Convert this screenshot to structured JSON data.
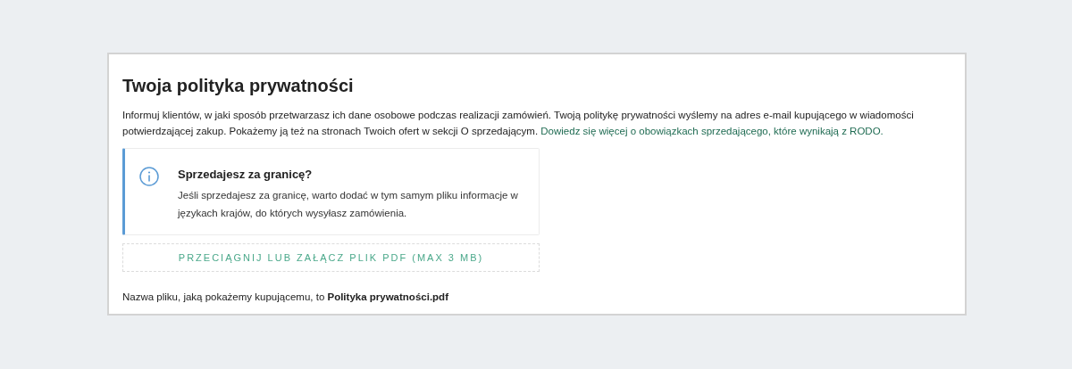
{
  "title": "Twoja polityka prywatności",
  "intro": {
    "text": "Informuj klientów, w jaki sposób przetwarzasz ich dane osobowe podczas realizacji zamówień. Twoją politykę prywatności wyślemy na adres e-mail kupującego w wiadomości potwierdzającej zakup. Pokażemy ją też na stronach Twoich ofert w sekcji O sprzedającym.",
    "link": "Dowiedz się więcej o obowiązkach sprzedającego, które wynikają z RODO."
  },
  "notice": {
    "title": "Sprzedajesz za granicę?",
    "text": "Jeśli sprzedajesz za granicę, warto dodać w tym samym pliku informacje w językach krajów, do których wysyłasz zamówienia."
  },
  "upload_button": "PRZECIĄGNIJ LUB ZAŁĄCZ PLIK PDF (MAX 3 MB)",
  "file_name_note": "Nazwa pliku, jaką pokażemy kupującemu, to **Polityka prywatności.pdf**"
}
